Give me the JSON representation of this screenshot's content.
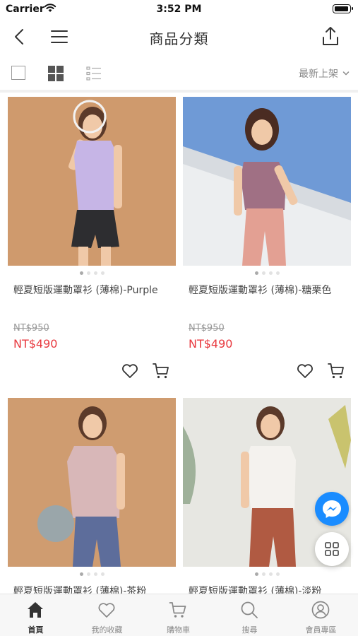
{
  "status_bar": {
    "carrier": "Carrier",
    "time": "3:52 PM"
  },
  "nav": {
    "title": "商品分類"
  },
  "toolbar": {
    "sort_label": "最新上架"
  },
  "products": [
    {
      "name": "輕夏短版運動罩衫 (薄棉)-Purple",
      "original_price": "NT$950",
      "sale_price": "NT$490"
    },
    {
      "name": "輕夏短版運動罩衫 (薄棉)-糖栗色",
      "original_price": "NT$950",
      "sale_price": "NT$490"
    },
    {
      "name": "輕夏短版運動罩衫 (薄棉)-茶粉",
      "original_price": "",
      "sale_price": ""
    },
    {
      "name": "輕夏短版運動罩衫 (薄棉)-淡粉",
      "original_price": "",
      "sale_price": ""
    }
  ],
  "tab_bar": {
    "items": [
      {
        "label": "首頁",
        "icon": "home-icon",
        "active": true
      },
      {
        "label": "我的收藏",
        "icon": "heart-icon",
        "active": false
      },
      {
        "label": "購物車",
        "icon": "cart-icon",
        "active": false
      },
      {
        "label": "搜尋",
        "icon": "search-icon",
        "active": false
      },
      {
        "label": "會員專區",
        "icon": "user-icon",
        "active": false
      }
    ]
  },
  "colors": {
    "accent": "#e8393f",
    "messenger": "#1a8cff",
    "text": "#333333",
    "muted": "#999999"
  }
}
